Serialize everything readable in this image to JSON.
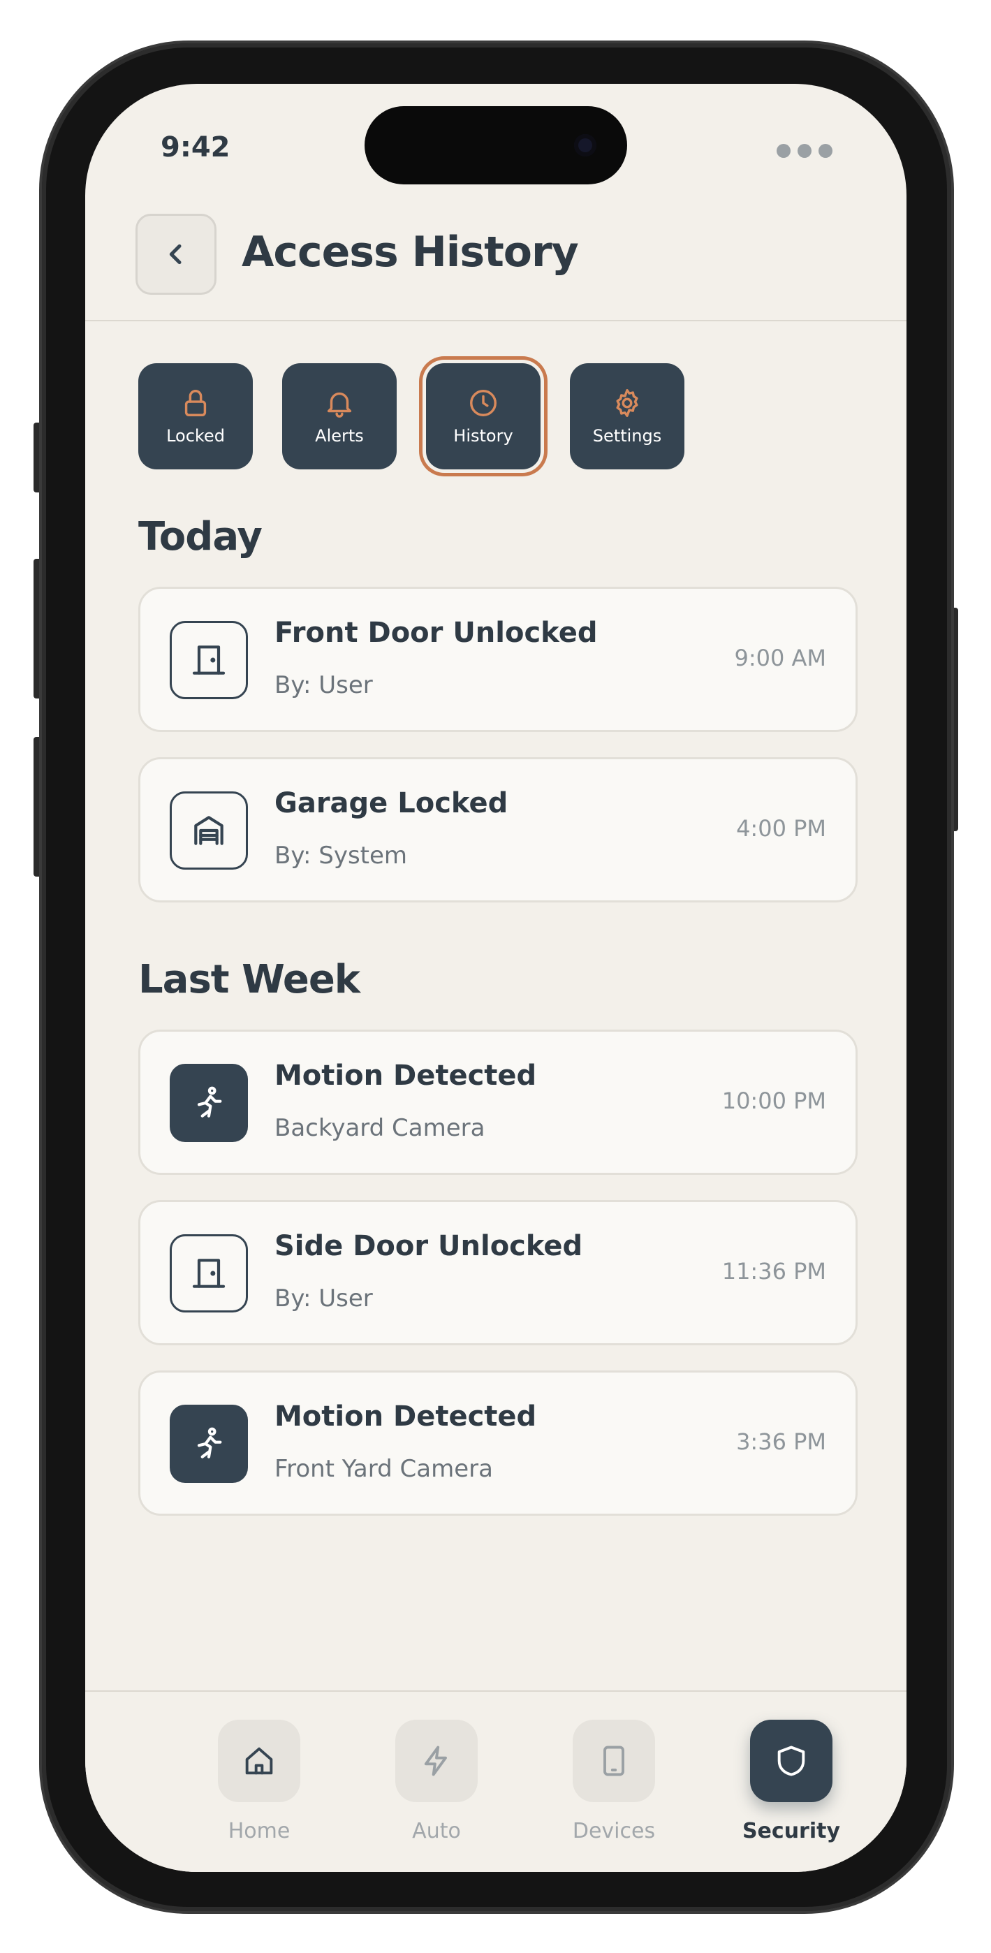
{
  "status_bar": {
    "time": "9:42"
  },
  "header": {
    "title": "Access History"
  },
  "filter_tabs": [
    {
      "label": "Locked",
      "icon": "lock-icon",
      "active": false
    },
    {
      "label": "Alerts",
      "icon": "bell-icon",
      "active": false
    },
    {
      "label": "History",
      "icon": "clock-icon",
      "active": true
    },
    {
      "label": "Settings",
      "icon": "gear-icon",
      "active": false
    }
  ],
  "sections": [
    {
      "title": "Today",
      "events": [
        {
          "title": "Front Door Unlocked",
          "subtitle": "By: User",
          "time": "9:00 AM",
          "icon": "door-icon",
          "icon_style": "outline"
        },
        {
          "title": "Garage Locked",
          "subtitle": "By: System",
          "time": "4:00 PM",
          "icon": "garage-icon",
          "icon_style": "outline"
        }
      ]
    },
    {
      "title": "Last Week",
      "events": [
        {
          "title": "Motion Detected",
          "subtitle": "Backyard Camera",
          "time": "10:00 PM",
          "icon": "running-person-icon",
          "icon_style": "solid"
        },
        {
          "title": "Side Door Unlocked",
          "subtitle": "By: User",
          "time": "11:36 PM",
          "icon": "door-icon",
          "icon_style": "outline"
        },
        {
          "title": "Motion Detected",
          "subtitle": "Front Yard Camera",
          "time": "3:36 PM",
          "icon": "running-person-icon",
          "icon_style": "solid"
        }
      ]
    }
  ],
  "bottom_nav": [
    {
      "label": "Home",
      "icon": "home-icon",
      "active": false
    },
    {
      "label": "Auto",
      "icon": "lightning-icon",
      "active": false
    },
    {
      "label": "Devices",
      "icon": "phone-device-icon",
      "active": false
    },
    {
      "label": "Security",
      "icon": "shield-icon",
      "active": true
    }
  ],
  "colors": {
    "background": "#f3f0ea",
    "dark_slate": "#354451",
    "accent": "#c97a4e",
    "text_primary": "#2f3a44",
    "text_secondary": "#6b737a"
  }
}
